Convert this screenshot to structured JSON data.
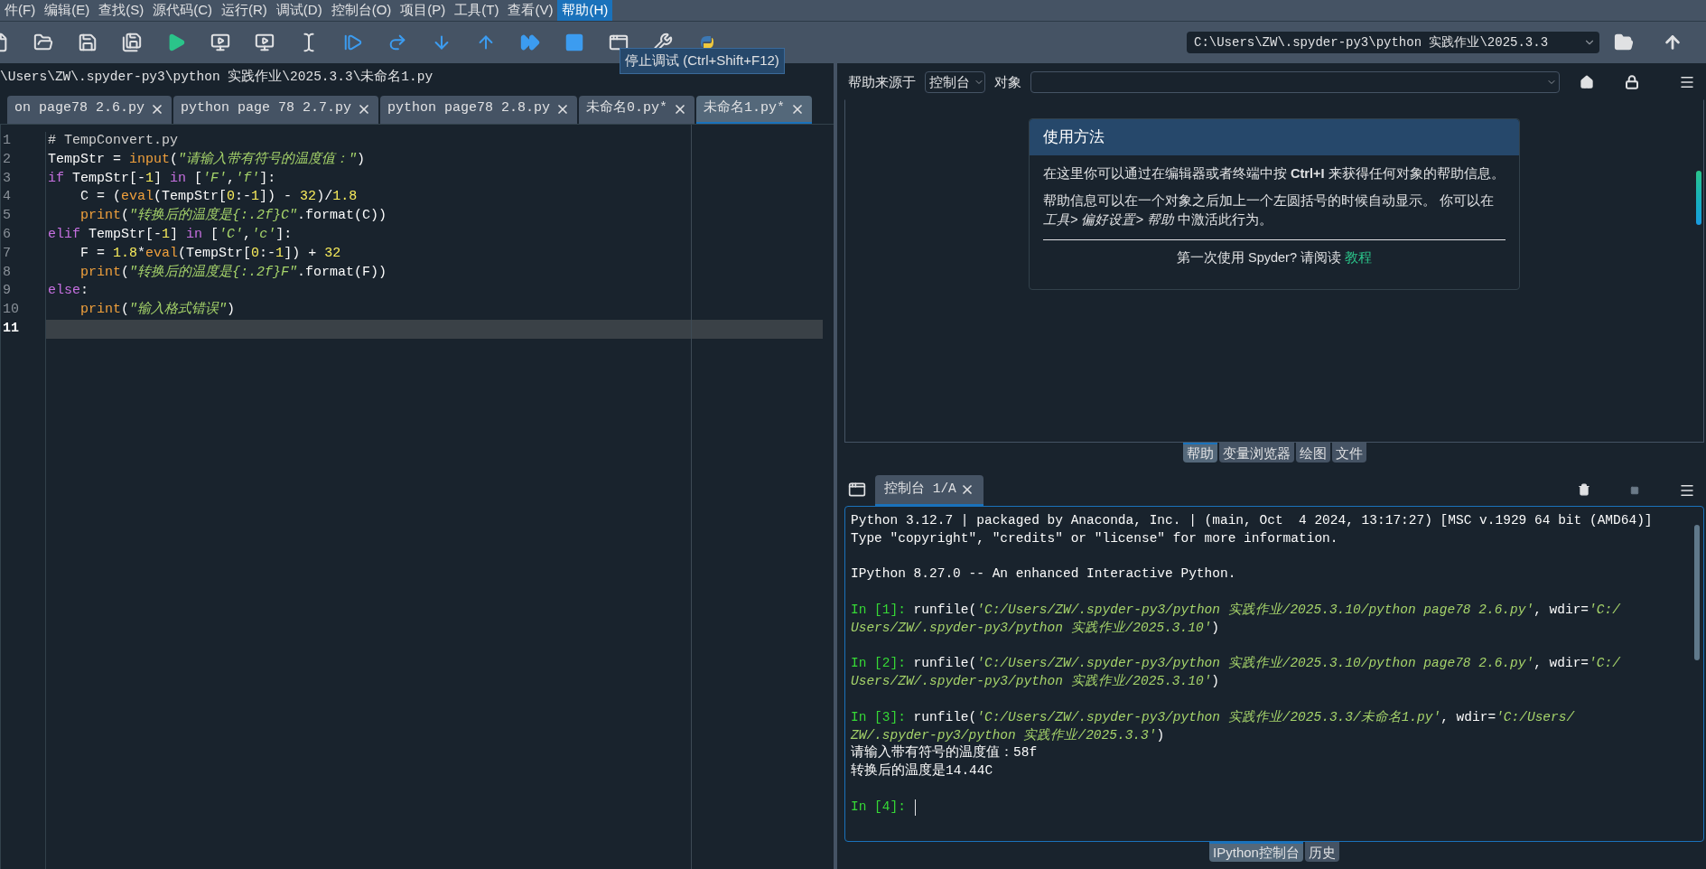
{
  "menu": [
    {
      "label": "件(F)",
      "selected": false
    },
    {
      "label": "编辑(E)",
      "selected": false
    },
    {
      "label": "查找(S)",
      "selected": false
    },
    {
      "label": "源代码(C)",
      "selected": false
    },
    {
      "label": "运行(R)",
      "selected": false
    },
    {
      "label": "调试(D)",
      "selected": false
    },
    {
      "label": "控制台(O)",
      "selected": false
    },
    {
      "label": "项目(P)",
      "selected": false
    },
    {
      "label": "工具(T)",
      "selected": false
    },
    {
      "label": "查看(V)",
      "selected": false
    },
    {
      "label": "帮助(H)",
      "selected": true
    }
  ],
  "toolbar": {
    "tooltip": "停止调试 (Ctrl+Shift+F12)",
    "path": "C:\\Users\\ZW\\.spyder-py3\\python 实践作业\\2025.3.3"
  },
  "editor": {
    "path": "\\Users\\ZW\\.spyder-py3\\python 实践作业\\2025.3.3\\未命名1.py",
    "tabs": [
      {
        "label": "on page78 2.6.py",
        "selected": false
      },
      {
        "label": "python page 78 2.7.py",
        "selected": false
      },
      {
        "label": "python page78 2.8.py",
        "selected": false
      },
      {
        "label": "未命名0.py*",
        "selected": false
      },
      {
        "label": "未命名1.py*",
        "selected": true
      }
    ],
    "lines": [
      {
        "number": "1",
        "current": false,
        "tokens": [
          {
            "kind": "comment",
            "text": "# TempConvert.py"
          }
        ]
      },
      {
        "number": "2",
        "current": false,
        "tokens": [
          {
            "kind": "plain",
            "text": "TempStr = "
          },
          {
            "kind": "builtin",
            "text": "input"
          },
          {
            "kind": "plain",
            "text": "("
          },
          {
            "kind": "string",
            "text": "\"请输入带有符号的温度值：\""
          },
          {
            "kind": "plain",
            "text": ")"
          }
        ]
      },
      {
        "number": "3",
        "current": false,
        "tokens": [
          {
            "kind": "keyword",
            "text": "if"
          },
          {
            "kind": "plain",
            "text": " TempStr[-"
          },
          {
            "kind": "number",
            "text": "1"
          },
          {
            "kind": "plain",
            "text": "] "
          },
          {
            "kind": "keyword",
            "text": "in"
          },
          {
            "kind": "plain",
            "text": " ["
          },
          {
            "kind": "string",
            "text": "'F'"
          },
          {
            "kind": "plain",
            "text": ","
          },
          {
            "kind": "string",
            "text": "'f'"
          },
          {
            "kind": "plain",
            "text": "]:"
          }
        ]
      },
      {
        "number": "4",
        "current": false,
        "tokens": [
          {
            "kind": "plain",
            "text": "    C = ("
          },
          {
            "kind": "builtin",
            "text": "eval"
          },
          {
            "kind": "plain",
            "text": "(TempStr["
          },
          {
            "kind": "number",
            "text": "0"
          },
          {
            "kind": "plain",
            "text": ":-"
          },
          {
            "kind": "number",
            "text": "1"
          },
          {
            "kind": "plain",
            "text": "]) - "
          },
          {
            "kind": "number",
            "text": "32"
          },
          {
            "kind": "plain",
            "text": ")/"
          },
          {
            "kind": "number",
            "text": "1.8"
          }
        ]
      },
      {
        "number": "5",
        "current": false,
        "tokens": [
          {
            "kind": "builtin",
            "text": "    print"
          },
          {
            "kind": "plain",
            "text": "("
          },
          {
            "kind": "string",
            "text": "\"转换后的温度是{:.2f}C\""
          },
          {
            "kind": "plain",
            "text": ".format(C))"
          }
        ]
      },
      {
        "number": "6",
        "current": false,
        "tokens": [
          {
            "kind": "keyword",
            "text": "elif"
          },
          {
            "kind": "plain",
            "text": " TempStr[-"
          },
          {
            "kind": "number",
            "text": "1"
          },
          {
            "kind": "plain",
            "text": "] "
          },
          {
            "kind": "keyword",
            "text": "in"
          },
          {
            "kind": "plain",
            "text": " ["
          },
          {
            "kind": "string",
            "text": "'C'"
          },
          {
            "kind": "plain",
            "text": ","
          },
          {
            "kind": "string",
            "text": "'c'"
          },
          {
            "kind": "plain",
            "text": "]:"
          }
        ]
      },
      {
        "number": "7",
        "current": false,
        "tokens": [
          {
            "kind": "plain",
            "text": "    F = "
          },
          {
            "kind": "number",
            "text": "1.8"
          },
          {
            "kind": "plain",
            "text": "*"
          },
          {
            "kind": "builtin",
            "text": "eval"
          },
          {
            "kind": "plain",
            "text": "(TempStr["
          },
          {
            "kind": "number",
            "text": "0"
          },
          {
            "kind": "plain",
            "text": ":-"
          },
          {
            "kind": "number",
            "text": "1"
          },
          {
            "kind": "plain",
            "text": "]) + "
          },
          {
            "kind": "number",
            "text": "32"
          }
        ]
      },
      {
        "number": "8",
        "current": false,
        "tokens": [
          {
            "kind": "builtin",
            "text": "    print"
          },
          {
            "kind": "plain",
            "text": "("
          },
          {
            "kind": "string",
            "text": "\"转换后的温度是{:.2f}F\""
          },
          {
            "kind": "plain",
            "text": ".format(F))"
          }
        ]
      },
      {
        "number": "9",
        "current": false,
        "tokens": [
          {
            "kind": "keyword",
            "text": "else"
          },
          {
            "kind": "plain",
            "text": ":"
          }
        ]
      },
      {
        "number": "10",
        "current": false,
        "tokens": [
          {
            "kind": "builtin",
            "text": "    print"
          },
          {
            "kind": "plain",
            "text": "("
          },
          {
            "kind": "string",
            "text": "\"输入格式错误\""
          },
          {
            "kind": "plain",
            "text": ")"
          }
        ]
      },
      {
        "number": "11",
        "current": true
      }
    ]
  },
  "help": {
    "source_label": "帮助来源于",
    "source_value": "控制台",
    "object_label": "对象",
    "card_title": "使用方法",
    "paragraphs": [
      [
        {
          "kind": "text",
          "text": "在这里你可以通过在编辑器或者终端中按 "
        },
        {
          "kind": "key",
          "text": "Ctrl+I"
        },
        {
          "kind": "text",
          "text": " 来获得任何对象的帮助信息。"
        }
      ],
      [
        {
          "kind": "text",
          "text": "帮助信息可以在一个对象之后加上一个左圆括号的时候自动显示。 你可以在"
        },
        {
          "kind": "menu_path",
          "text": "工具> 偏好设置> 帮助"
        },
        {
          "kind": "text",
          "text": " 中激活此行为。"
        }
      ]
    ],
    "footer": "第一次使用 Spyder? 请阅读",
    "footer_link": "教程",
    "tabs": [
      {
        "label": "帮助",
        "selected": true
      },
      {
        "label": "变量浏览器",
        "selected": false
      },
      {
        "label": "绘图",
        "selected": false
      },
      {
        "label": "文件",
        "selected": false
      }
    ]
  },
  "console": {
    "tab": {
      "label": "控制台 1/A",
      "selected": true
    },
    "blocks": [
      [
        [
          {
            "kind": "plain",
            "text": "Python 3.12.7 | packaged by Anaconda, Inc. | (main, Oct  4 2024, 13:17:27) [MSC v.1929 64 bit (AMD64)]"
          }
        ],
        [
          {
            "kind": "plain",
            "text": "Type \"copyright\", \"credits\" or \"license\" for more information."
          }
        ]
      ],
      [
        [
          {
            "kind": "plain",
            "text": "IPython 8.27.0 -- An enhanced Interactive Python."
          }
        ]
      ],
      [
        [
          {
            "kind": "prompt",
            "text": "In [1]:"
          },
          {
            "kind": "plain",
            "text": " runfile("
          },
          {
            "kind": "string",
            "text": "'C:/Users/ZW/.spyder-py3/python 实践作业/2025.3.10/python page78 2.6.py'"
          },
          {
            "kind": "plain",
            "text": ", wdir="
          },
          {
            "kind": "string",
            "text": "'C:/"
          }
        ],
        [
          {
            "kind": "string",
            "text": "Users/ZW/.spyder-py3/python 实践作业/2025.3.10'"
          },
          {
            "kind": "plain",
            "text": ")"
          }
        ]
      ],
      [
        [
          {
            "kind": "prompt",
            "text": "In [2]:"
          },
          {
            "kind": "plain",
            "text": " runfile("
          },
          {
            "kind": "string",
            "text": "'C:/Users/ZW/.spyder-py3/python 实践作业/2025.3.10/python page78 2.6.py'"
          },
          {
            "kind": "plain",
            "text": ", wdir="
          },
          {
            "kind": "string",
            "text": "'C:/"
          }
        ],
        [
          {
            "kind": "string",
            "text": "Users/ZW/.spyder-py3/python 实践作业/2025.3.10'"
          },
          {
            "kind": "plain",
            "text": ")"
          }
        ]
      ],
      [
        [
          {
            "kind": "prompt",
            "text": "In [3]:"
          },
          {
            "kind": "plain",
            "text": " runfile("
          },
          {
            "kind": "string",
            "text": "'C:/Users/ZW/.spyder-py3/python 实践作业/2025.3.3/未命名1.py'"
          },
          {
            "kind": "plain",
            "text": ", wdir="
          },
          {
            "kind": "string",
            "text": "'C:/Users/"
          }
        ],
        [
          {
            "kind": "string",
            "text": "ZW/.spyder-py3/python 实践作业/2025.3.3'"
          },
          {
            "kind": "plain",
            "text": ")"
          }
        ],
        [
          {
            "kind": "plain",
            "text": "请输入带有符号的温度值：58f"
          }
        ],
        [
          {
            "kind": "plain",
            "text": "转换后的温度是14.44C"
          }
        ]
      ],
      [
        [
          {
            "kind": "prompt",
            "text": "In [4]:"
          }
        ]
      ]
    ],
    "tabs": [
      {
        "label": "IPython控制台",
        "selected": true
      },
      {
        "label": "历史",
        "selected": false
      }
    ]
  }
}
